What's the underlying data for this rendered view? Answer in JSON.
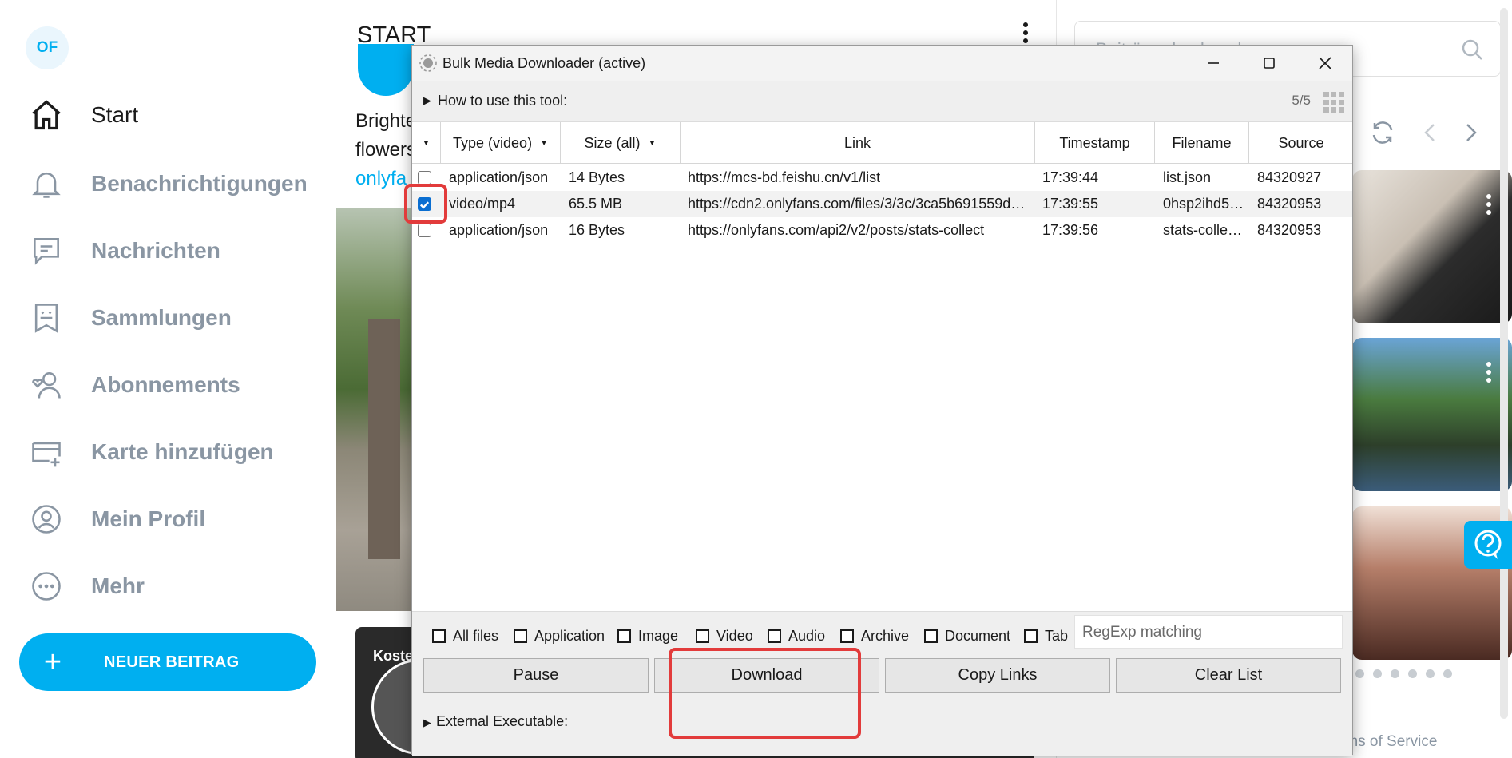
{
  "sidebar": {
    "avatar_initials": "OF",
    "items": [
      {
        "label": "Start",
        "icon": "home-icon"
      },
      {
        "label": "Benachrichtigungen",
        "icon": "bell-icon"
      },
      {
        "label": "Nachrichten",
        "icon": "message-icon"
      },
      {
        "label": "Sammlungen",
        "icon": "collections-icon"
      },
      {
        "label": "Abonnements",
        "icon": "subscriptions-icon"
      },
      {
        "label": "Karte hinzufügen",
        "icon": "card-add-icon"
      },
      {
        "label": "Mein Profil",
        "icon": "profile-icon"
      },
      {
        "label": "Mehr",
        "icon": "more-icon"
      }
    ],
    "new_post_label": "NEUER BEITRAG"
  },
  "feed": {
    "title": "START",
    "post_text_line1": "Brighte",
    "post_text_line2": "flowers",
    "post_link": "onlyfa",
    "card_tag": "Koste"
  },
  "right": {
    "search_placeholder": "Beiträge durchsuchen",
    "terms_text": "rms of Service"
  },
  "dialog": {
    "title": "Bulk Media Downloader (active)",
    "howto_label": "How to use this tool:",
    "counter": "5/5",
    "columns": {
      "type": "Type (video)",
      "size": "Size (all)",
      "link": "Link",
      "timestamp": "Timestamp",
      "filename": "Filename",
      "source": "Source"
    },
    "rows": [
      {
        "checked": false,
        "type": "application/json",
        "size": "14 Bytes",
        "link": "https://mcs-bd.feishu.cn/v1/list",
        "timestamp": "17:39:44",
        "filename": "list.json",
        "source": "84320927"
      },
      {
        "checked": true,
        "type": "video/mp4",
        "size": "65.5 MB",
        "link": "https://cdn2.onlyfans.com/files/3/3c/3ca5b691559d72…",
        "timestamp": "17:39:55",
        "filename": "0hsp2ihd5kj…",
        "source": "84320953"
      },
      {
        "checked": false,
        "type": "application/json",
        "size": "16 Bytes",
        "link": "https://onlyfans.com/api2/v2/posts/stats-collect",
        "timestamp": "17:39:56",
        "filename": "stats-collect…",
        "source": "84320953"
      }
    ],
    "filters": [
      "All files",
      "Application",
      "Image",
      "Video",
      "Audio",
      "Archive",
      "Document",
      "Tab"
    ],
    "regexp_placeholder": "RegExp matching",
    "buttons": {
      "pause": "Pause",
      "download": "Download",
      "copy_links": "Copy Links",
      "clear_list": "Clear List"
    },
    "external_label": "External Executable:"
  },
  "colors": {
    "accent": "#00aff0",
    "highlight": "#e23b3b",
    "checkbox": "#0a6ed1"
  }
}
